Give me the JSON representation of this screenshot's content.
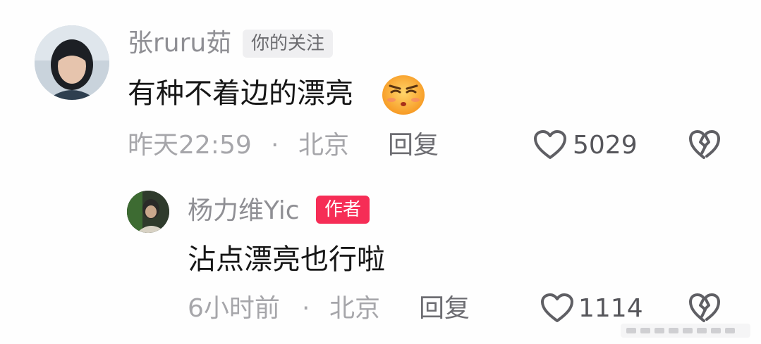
{
  "comments": [
    {
      "username": "张ruru茹",
      "tag": "你的关注",
      "content": "有种不着边的漂亮",
      "emoji": "smirk-face",
      "time": "昨天22:59",
      "separator": "·",
      "location": "北京",
      "reply_label": "回复",
      "likes": "5029",
      "like_icon": "heart-outline-icon",
      "dislike_icon": "broken-heart-icon"
    },
    {
      "username": "杨力维Yic",
      "tag": "作者",
      "content": "沾点漂亮也行啦",
      "time": "6小时前",
      "separator": "·",
      "location": "北京",
      "reply_label": "回复",
      "likes": "1114",
      "like_icon": "heart-outline-icon",
      "dislike_icon": "broken-heart-icon"
    }
  ],
  "colors": {
    "author_tag": "#f62d56",
    "follow_tag_bg": "#efeff1",
    "muted_text": "#a6a6aa"
  }
}
